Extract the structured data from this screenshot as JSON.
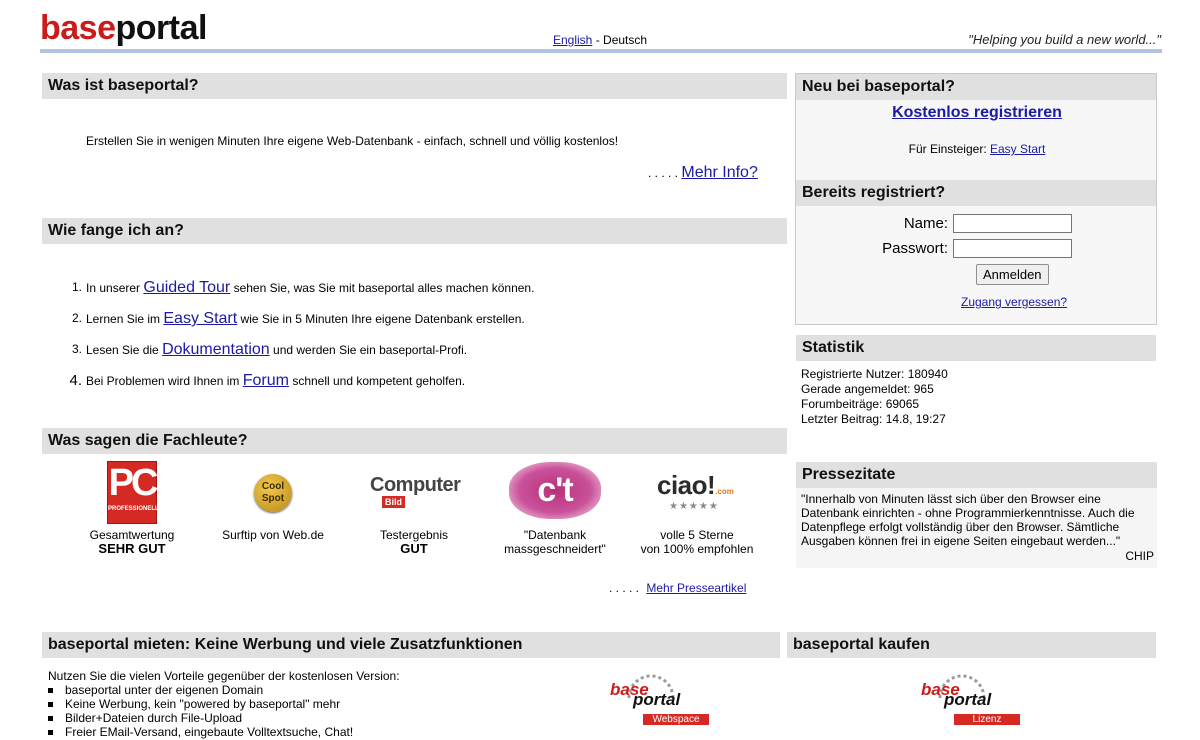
{
  "header": {
    "logo_base": "base",
    "logo_portal": "portal",
    "lang_english": "English",
    "lang_sep": " - ",
    "lang_deutsch": "Deutsch",
    "slogan": "\"Helping you build a new world...\""
  },
  "what": {
    "title": "Was ist baseportal?",
    "text": "Erstellen Sie in wenigen Minuten Ihre eigene Web-Datenbank - einfach, schnell und völlig kostenlos!",
    "more_dots": ". . . . .",
    "more_link": "Mehr Info?"
  },
  "start": {
    "title": "Wie fange ich an?",
    "steps": [
      {
        "num": "1.",
        "pre": "In unserer ",
        "link": "Guided Tour",
        "post": " sehen Sie, was Sie mit baseportal alles machen können."
      },
      {
        "num": "2.",
        "pre": "Lernen Sie im ",
        "link": "Easy Start",
        "post": " wie Sie in 5 Minuten Ihre eigene Datenbank erstellen."
      },
      {
        "num": "3.",
        "pre": "Lesen Sie die ",
        "link": "Dokumentation",
        "post": " und werden Sie ein baseportal-Profi."
      },
      {
        "num": "4.",
        "pre": "Bei Problemen wird Ihnen im ",
        "link": "Forum",
        "post": " schnell und kompetent geholfen."
      }
    ]
  },
  "experts": {
    "title": "Was sagen die Fachleute?",
    "items": [
      {
        "logo_text": "PC",
        "logo_sub": "PROFESSIONELL",
        "line1": "Gesamtwertung",
        "line2": "SEHR GUT"
      },
      {
        "logo_text": "Cool Spot",
        "line1": "Surftip von Web.de",
        "line2": ""
      },
      {
        "logo_text": "Computer",
        "logo_sub": "Bild",
        "line1": "Testergebnis",
        "line2": "GUT"
      },
      {
        "logo_text": "c't",
        "line1": "\"Datenbank",
        "line2": "massgeschneidert\""
      },
      {
        "logo_text": "ciao!",
        "logo_sub": ".com",
        "stars": "★★★★★",
        "line1": "volle 5 Sterne",
        "line2": "von 100% empfohlen"
      }
    ],
    "more_dots": ". . . . .",
    "more_link": "Mehr Presseartikel"
  },
  "newuser": {
    "title": "Neu bei baseportal?",
    "register": "Kostenlos registrieren",
    "beginner_label": "Für Einsteiger: ",
    "beginner_link": "Easy Start"
  },
  "login": {
    "title": "Bereits registriert?",
    "name_label": "Name:",
    "name_value": "",
    "password_label": "Passwort:",
    "password_value": "",
    "submit": "Anmelden",
    "forgot": "Zugang vergessen?"
  },
  "stats": {
    "title": "Statistik",
    "lines": [
      "Registrierte Nutzer: 180940",
      "Gerade angemeldet: 965",
      "Forumbeiträge: 69065",
      "Letzter Beitrag: 14.8, 19:27"
    ]
  },
  "press": {
    "title": "Pressezitate",
    "quote": "\"Innerhalb von Minuten lässt sich über den Browser eine Datenbank einrichten - ohne Programmierkenntnisse. Auch die Datenpflege erfolgt vollständig über den Browser. Sämtliche Ausgaben können frei in eigene Seiten eingebaut werden...\"",
    "source": "CHIP"
  },
  "rent": {
    "title": "baseportal mieten: Keine Werbung und viele Zusatzfunktionen",
    "intro": "Nutzen Sie die vielen Vorteile gegenüber der kostenlosen Version:",
    "features": [
      "baseportal unter der eigenen Domain",
      "Keine Werbung, kein \"powered by baseportal\" mehr",
      "Bilder+Dateien durch File-Upload",
      "Freier EMail-Versand, eingebaute Volltextsuche, Chat!"
    ],
    "logo_base": "base",
    "logo_portal": "portal",
    "logo_tag": "Webspace"
  },
  "buy": {
    "title": "baseportal kaufen",
    "logo_base": "base",
    "logo_portal": "portal",
    "logo_tag": "Lizenz"
  }
}
